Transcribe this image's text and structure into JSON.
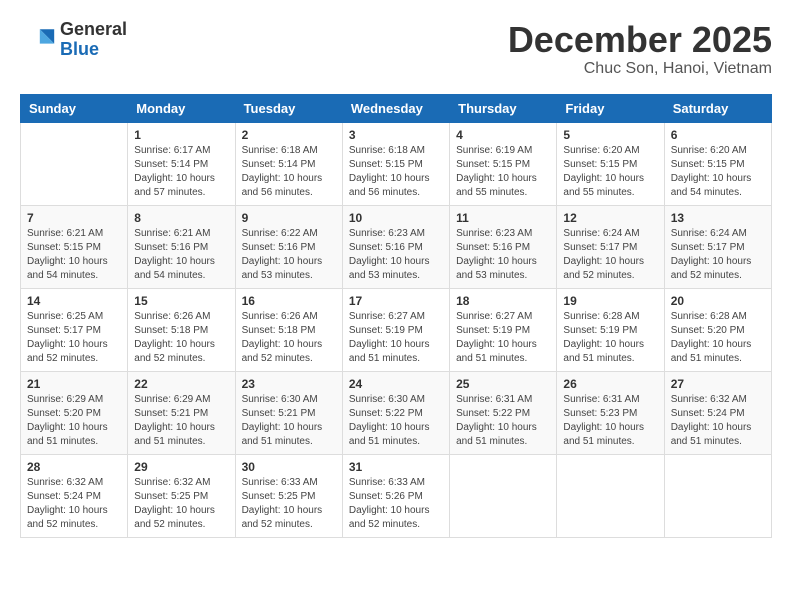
{
  "header": {
    "logo_general": "General",
    "logo_blue": "Blue",
    "month_title": "December 2025",
    "location": "Chuc Son, Hanoi, Vietnam"
  },
  "weekdays": [
    "Sunday",
    "Monday",
    "Tuesday",
    "Wednesday",
    "Thursday",
    "Friday",
    "Saturday"
  ],
  "weeks": [
    [
      {
        "day": "",
        "info": ""
      },
      {
        "day": "1",
        "info": "Sunrise: 6:17 AM\nSunset: 5:14 PM\nDaylight: 10 hours\nand 57 minutes."
      },
      {
        "day": "2",
        "info": "Sunrise: 6:18 AM\nSunset: 5:14 PM\nDaylight: 10 hours\nand 56 minutes."
      },
      {
        "day": "3",
        "info": "Sunrise: 6:18 AM\nSunset: 5:15 PM\nDaylight: 10 hours\nand 56 minutes."
      },
      {
        "day": "4",
        "info": "Sunrise: 6:19 AM\nSunset: 5:15 PM\nDaylight: 10 hours\nand 55 minutes."
      },
      {
        "day": "5",
        "info": "Sunrise: 6:20 AM\nSunset: 5:15 PM\nDaylight: 10 hours\nand 55 minutes."
      },
      {
        "day": "6",
        "info": "Sunrise: 6:20 AM\nSunset: 5:15 PM\nDaylight: 10 hours\nand 54 minutes."
      }
    ],
    [
      {
        "day": "7",
        "info": "Sunrise: 6:21 AM\nSunset: 5:15 PM\nDaylight: 10 hours\nand 54 minutes."
      },
      {
        "day": "8",
        "info": "Sunrise: 6:21 AM\nSunset: 5:16 PM\nDaylight: 10 hours\nand 54 minutes."
      },
      {
        "day": "9",
        "info": "Sunrise: 6:22 AM\nSunset: 5:16 PM\nDaylight: 10 hours\nand 53 minutes."
      },
      {
        "day": "10",
        "info": "Sunrise: 6:23 AM\nSunset: 5:16 PM\nDaylight: 10 hours\nand 53 minutes."
      },
      {
        "day": "11",
        "info": "Sunrise: 6:23 AM\nSunset: 5:16 PM\nDaylight: 10 hours\nand 53 minutes."
      },
      {
        "day": "12",
        "info": "Sunrise: 6:24 AM\nSunset: 5:17 PM\nDaylight: 10 hours\nand 52 minutes."
      },
      {
        "day": "13",
        "info": "Sunrise: 6:24 AM\nSunset: 5:17 PM\nDaylight: 10 hours\nand 52 minutes."
      }
    ],
    [
      {
        "day": "14",
        "info": "Sunrise: 6:25 AM\nSunset: 5:17 PM\nDaylight: 10 hours\nand 52 minutes."
      },
      {
        "day": "15",
        "info": "Sunrise: 6:26 AM\nSunset: 5:18 PM\nDaylight: 10 hours\nand 52 minutes."
      },
      {
        "day": "16",
        "info": "Sunrise: 6:26 AM\nSunset: 5:18 PM\nDaylight: 10 hours\nand 52 minutes."
      },
      {
        "day": "17",
        "info": "Sunrise: 6:27 AM\nSunset: 5:19 PM\nDaylight: 10 hours\nand 51 minutes."
      },
      {
        "day": "18",
        "info": "Sunrise: 6:27 AM\nSunset: 5:19 PM\nDaylight: 10 hours\nand 51 minutes."
      },
      {
        "day": "19",
        "info": "Sunrise: 6:28 AM\nSunset: 5:19 PM\nDaylight: 10 hours\nand 51 minutes."
      },
      {
        "day": "20",
        "info": "Sunrise: 6:28 AM\nSunset: 5:20 PM\nDaylight: 10 hours\nand 51 minutes."
      }
    ],
    [
      {
        "day": "21",
        "info": "Sunrise: 6:29 AM\nSunset: 5:20 PM\nDaylight: 10 hours\nand 51 minutes."
      },
      {
        "day": "22",
        "info": "Sunrise: 6:29 AM\nSunset: 5:21 PM\nDaylight: 10 hours\nand 51 minutes."
      },
      {
        "day": "23",
        "info": "Sunrise: 6:30 AM\nSunset: 5:21 PM\nDaylight: 10 hours\nand 51 minutes."
      },
      {
        "day": "24",
        "info": "Sunrise: 6:30 AM\nSunset: 5:22 PM\nDaylight: 10 hours\nand 51 minutes."
      },
      {
        "day": "25",
        "info": "Sunrise: 6:31 AM\nSunset: 5:22 PM\nDaylight: 10 hours\nand 51 minutes."
      },
      {
        "day": "26",
        "info": "Sunrise: 6:31 AM\nSunset: 5:23 PM\nDaylight: 10 hours\nand 51 minutes."
      },
      {
        "day": "27",
        "info": "Sunrise: 6:32 AM\nSunset: 5:24 PM\nDaylight: 10 hours\nand 51 minutes."
      }
    ],
    [
      {
        "day": "28",
        "info": "Sunrise: 6:32 AM\nSunset: 5:24 PM\nDaylight: 10 hours\nand 52 minutes."
      },
      {
        "day": "29",
        "info": "Sunrise: 6:32 AM\nSunset: 5:25 PM\nDaylight: 10 hours\nand 52 minutes."
      },
      {
        "day": "30",
        "info": "Sunrise: 6:33 AM\nSunset: 5:25 PM\nDaylight: 10 hours\nand 52 minutes."
      },
      {
        "day": "31",
        "info": "Sunrise: 6:33 AM\nSunset: 5:26 PM\nDaylight: 10 hours\nand 52 minutes."
      },
      {
        "day": "",
        "info": ""
      },
      {
        "day": "",
        "info": ""
      },
      {
        "day": "",
        "info": ""
      }
    ]
  ]
}
